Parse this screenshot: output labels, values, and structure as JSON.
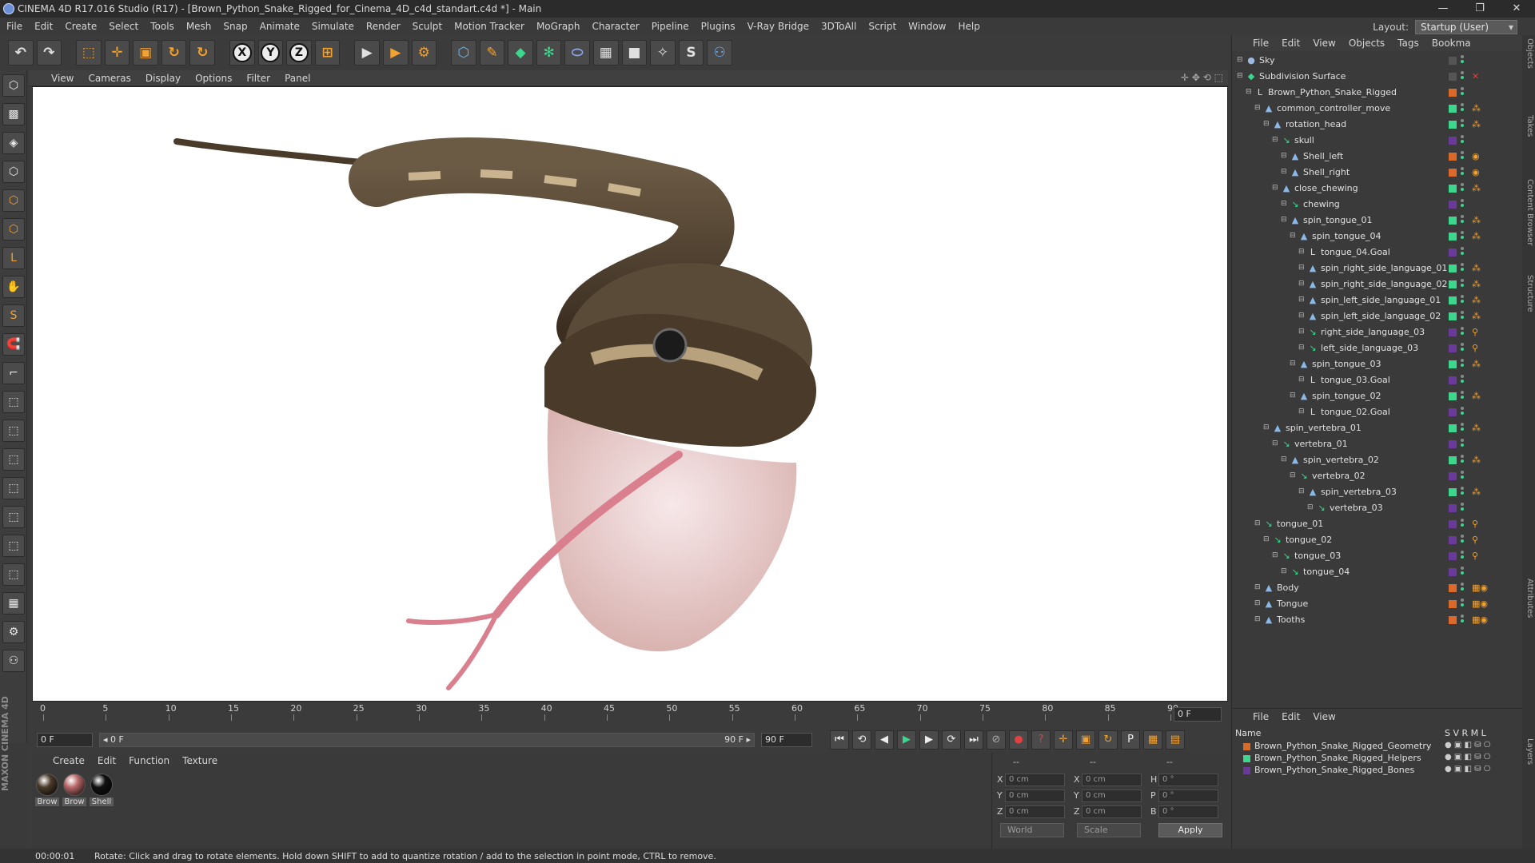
{
  "window": {
    "title": "CINEMA 4D R17.016 Studio (R17) - [Brown_Python_Snake_Rigged_for_Cinema_4D_c4d_standart.c4d *] - Main",
    "controls": [
      "—",
      "❐",
      "✕"
    ]
  },
  "menu": [
    "File",
    "Edit",
    "Create",
    "Select",
    "Tools",
    "Mesh",
    "Snap",
    "Animate",
    "Simulate",
    "Render",
    "Sculpt",
    "Motion Tracker",
    "MoGraph",
    "Character",
    "Pipeline",
    "Plugins",
    "V-Ray Bridge",
    "3DToAll",
    "Script",
    "Window",
    "Help"
  ],
  "layout": {
    "label": "Layout:",
    "value": "Startup (User)"
  },
  "toolbar": {
    "undo": "↶",
    "redo": "↷",
    "select": "⬚",
    "move": "✛",
    "scale": "▣",
    "rotate": "↻",
    "rotate2": "↻",
    "x": "X",
    "y": "Y",
    "z": "Z",
    "coord": "⊞",
    "render_view": "▶",
    "render_pic": "▶",
    "render_settings": "⚙",
    "cube": "⬡",
    "pen": "✎",
    "subdiv": "◆",
    "array": "✻",
    "deformer": "⬭",
    "floor": "▦",
    "camera": "■",
    "light": "✧",
    "python1": "S",
    "python2": "⚇"
  },
  "left_tools": [
    "⬡",
    "▩",
    "◈",
    "⬡",
    "⬡",
    "⬡",
    "L",
    "✋",
    "S",
    "🧲",
    "⌐",
    "⬚",
    "⬚",
    "⬚",
    "⬚",
    "⬚",
    "⬚",
    "⬚",
    "▦",
    "⚙",
    "⚇"
  ],
  "viewport": {
    "menu": [
      "View",
      "Cameras",
      "Display",
      "Options",
      "Filter",
      "Panel"
    ],
    "nav": "✛ ✥ ⟲ ⬚"
  },
  "timeline": {
    "ticks": [
      "0",
      "5",
      "10",
      "15",
      "20",
      "25",
      "30",
      "35",
      "40",
      "45",
      "50",
      "55",
      "60",
      "65",
      "70",
      "75",
      "80",
      "85",
      "90"
    ],
    "current": "0 F"
  },
  "playbar": {
    "start": "0 F",
    "range_start": "◂ 0 F",
    "range_end": "90 F ▸",
    "end": "90 F",
    "buttons": [
      "⏮",
      "⟲",
      "◀",
      "▶",
      "▶",
      "⟳",
      "⏭",
      "⊘",
      "●",
      "?",
      "✛",
      "▣",
      "↻",
      "P",
      "▦",
      "▤"
    ]
  },
  "materials": {
    "menu": [
      "Create",
      "Edit",
      "Function",
      "Texture"
    ],
    "items": [
      {
        "label": "Brow",
        "color": "#4a3b2a"
      },
      {
        "label": "Brow",
        "color": "#b86868"
      },
      {
        "label": "Shell",
        "color": "#111111"
      }
    ]
  },
  "coords": {
    "header": [
      "--",
      "--",
      "--"
    ],
    "rows": [
      {
        "a": "X",
        "av": "0 cm",
        "b": "X",
        "bv": "0 cm",
        "c": "H",
        "cv": "0 °"
      },
      {
        "a": "Y",
        "av": "0 cm",
        "b": "Y",
        "bv": "0 cm",
        "c": "P",
        "cv": "0 °"
      },
      {
        "a": "Z",
        "av": "0 cm",
        "b": "Z",
        "bv": "0 cm",
        "c": "B",
        "cv": "0 °"
      }
    ],
    "mode1": "World",
    "mode2": "Scale",
    "apply": "Apply"
  },
  "brand": "MAXON CINEMA 4D",
  "status": {
    "time": "00:00:01",
    "message": "Rotate: Click and drag to rotate elements. Hold down SHIFT to add to quantize rotation / add to the selection in point mode, CTRL to remove."
  },
  "objects": {
    "menu": [
      "File",
      "Edit",
      "View",
      "Objects",
      "Tags",
      "Bookma"
    ],
    "rows": [
      {
        "name": "Sky",
        "level": 0,
        "icon": "●",
        "icol": "#9bb8e0",
        "sq": "#555555",
        "tag": ""
      },
      {
        "name": "Subdivision Surface",
        "level": 0,
        "icon": "◆",
        "icol": "#3cd68c",
        "sq": "#555555",
        "tag": "✕"
      },
      {
        "name": "Brown_Python_Snake_Rigged",
        "level": 1,
        "icon": "L",
        "icol": "#dddddd",
        "sq": "#d96a2a",
        "tag": ""
      },
      {
        "name": "common_controller_move",
        "level": 2,
        "icon": "▲",
        "icol": "#8ab8e8",
        "sq": "#3cd68c",
        "tag": "⁂"
      },
      {
        "name": "rotation_head",
        "level": 3,
        "icon": "▲",
        "icol": "#8ab8e8",
        "sq": "#3cd68c",
        "tag": "⁂"
      },
      {
        "name": "skull",
        "level": 4,
        "icon": "↘",
        "icol": "#3cd68c",
        "sq": "#6a3a9a",
        "tag": ""
      },
      {
        "name": "Shell_left",
        "level": 5,
        "icon": "▲",
        "icol": "#8ab8e8",
        "sq": "#d96a2a",
        "tag": "◉"
      },
      {
        "name": "Shell_right",
        "level": 5,
        "icon": "▲",
        "icol": "#8ab8e8",
        "sq": "#d96a2a",
        "tag": "◉"
      },
      {
        "name": "close_chewing",
        "level": 4,
        "icon": "▲",
        "icol": "#8ab8e8",
        "sq": "#3cd68c",
        "tag": "⁂"
      },
      {
        "name": "chewing",
        "level": 5,
        "icon": "↘",
        "icol": "#3cd68c",
        "sq": "#6a3a9a",
        "tag": ""
      },
      {
        "name": "spin_tongue_01",
        "level": 5,
        "icon": "▲",
        "icol": "#8ab8e8",
        "sq": "#3cd68c",
        "tag": "⁂"
      },
      {
        "name": "spin_tongue_04",
        "level": 6,
        "icon": "▲",
        "icol": "#8ab8e8",
        "sq": "#3cd68c",
        "tag": "⁂"
      },
      {
        "name": "tongue_04.Goal",
        "level": 7,
        "icon": "L",
        "icol": "#dddddd",
        "sq": "#6a3a9a",
        "tag": ""
      },
      {
        "name": "spin_right_side_language_01",
        "level": 7,
        "icon": "▲",
        "icol": "#8ab8e8",
        "sq": "#3cd68c",
        "tag": "⁂"
      },
      {
        "name": "spin_right_side_language_02",
        "level": 7,
        "icon": "▲",
        "icol": "#8ab8e8",
        "sq": "#3cd68c",
        "tag": "⁂"
      },
      {
        "name": "spin_left_side_language_01",
        "level": 7,
        "icon": "▲",
        "icol": "#8ab8e8",
        "sq": "#3cd68c",
        "tag": "⁂"
      },
      {
        "name": "spin_left_side_language_02",
        "level": 7,
        "icon": "▲",
        "icol": "#8ab8e8",
        "sq": "#3cd68c",
        "tag": "⁂"
      },
      {
        "name": "right_side_language_03",
        "level": 7,
        "icon": "↘",
        "icol": "#3cd68c",
        "sq": "#6a3a9a",
        "tag": "⚲"
      },
      {
        "name": "left_side_language_03",
        "level": 7,
        "icon": "↘",
        "icol": "#3cd68c",
        "sq": "#6a3a9a",
        "tag": "⚲"
      },
      {
        "name": "spin_tongue_03",
        "level": 6,
        "icon": "▲",
        "icol": "#8ab8e8",
        "sq": "#3cd68c",
        "tag": "⁂"
      },
      {
        "name": "tongue_03.Goal",
        "level": 7,
        "icon": "L",
        "icol": "#dddddd",
        "sq": "#6a3a9a",
        "tag": ""
      },
      {
        "name": "spin_tongue_02",
        "level": 6,
        "icon": "▲",
        "icol": "#8ab8e8",
        "sq": "#3cd68c",
        "tag": "⁂"
      },
      {
        "name": "tongue_02.Goal",
        "level": 7,
        "icon": "L",
        "icol": "#dddddd",
        "sq": "#6a3a9a",
        "tag": ""
      },
      {
        "name": "spin_vertebra_01",
        "level": 3,
        "icon": "▲",
        "icol": "#8ab8e8",
        "sq": "#3cd68c",
        "tag": "⁂"
      },
      {
        "name": "vertebra_01",
        "level": 4,
        "icon": "↘",
        "icol": "#3cd68c",
        "sq": "#6a3a9a",
        "tag": ""
      },
      {
        "name": "spin_vertebra_02",
        "level": 5,
        "icon": "▲",
        "icol": "#8ab8e8",
        "sq": "#3cd68c",
        "tag": "⁂"
      },
      {
        "name": "vertebra_02",
        "level": 6,
        "icon": "↘",
        "icol": "#3cd68c",
        "sq": "#6a3a9a",
        "tag": ""
      },
      {
        "name": "spin_vertebra_03",
        "level": 7,
        "icon": "▲",
        "icol": "#8ab8e8",
        "sq": "#3cd68c",
        "tag": "⁂"
      },
      {
        "name": "vertebra_03",
        "level": 8,
        "icon": "↘",
        "icol": "#3cd68c",
        "sq": "#6a3a9a",
        "tag": ""
      },
      {
        "name": "tongue_01",
        "level": 2,
        "icon": "↘",
        "icol": "#3cd68c",
        "sq": "#6a3a9a",
        "tag": "⚲"
      },
      {
        "name": "tongue_02",
        "level": 3,
        "icon": "↘",
        "icol": "#3cd68c",
        "sq": "#6a3a9a",
        "tag": "⚲"
      },
      {
        "name": "tongue_03",
        "level": 4,
        "icon": "↘",
        "icol": "#3cd68c",
        "sq": "#6a3a9a",
        "tag": "⚲"
      },
      {
        "name": "tongue_04",
        "level": 5,
        "icon": "↘",
        "icol": "#3cd68c",
        "sq": "#6a3a9a",
        "tag": ""
      },
      {
        "name": "Body",
        "level": 2,
        "icon": "▲",
        "icol": "#8ab8e8",
        "sq": "#d96a2a",
        "tag": "▦◉"
      },
      {
        "name": "Tongue",
        "level": 2,
        "icon": "▲",
        "icol": "#8ab8e8",
        "sq": "#d96a2a",
        "tag": "▦◉"
      },
      {
        "name": "Tooths",
        "level": 2,
        "icon": "▲",
        "icol": "#8ab8e8",
        "sq": "#d96a2a",
        "tag": "▦◉"
      }
    ]
  },
  "layers": {
    "menu": [
      "File",
      "Edit",
      "View"
    ],
    "header": {
      "name": "Name",
      "cols": "S V R M L"
    },
    "rows": [
      {
        "name": "Brown_Python_Snake_Rigged_Geometry",
        "color": "#d96a2a"
      },
      {
        "name": "Brown_Python_Snake_Rigged_Helpers",
        "color": "#3cd68c"
      },
      {
        "name": "Brown_Python_Snake_Rigged_Bones",
        "color": "#6a3a9a"
      }
    ],
    "icons": "● ▣ ◧ ⛁ ⎔"
  },
  "side_tabs": [
    "Objects",
    "Takes",
    "Content Browser",
    "Structure",
    "Attributes",
    "Layers"
  ]
}
